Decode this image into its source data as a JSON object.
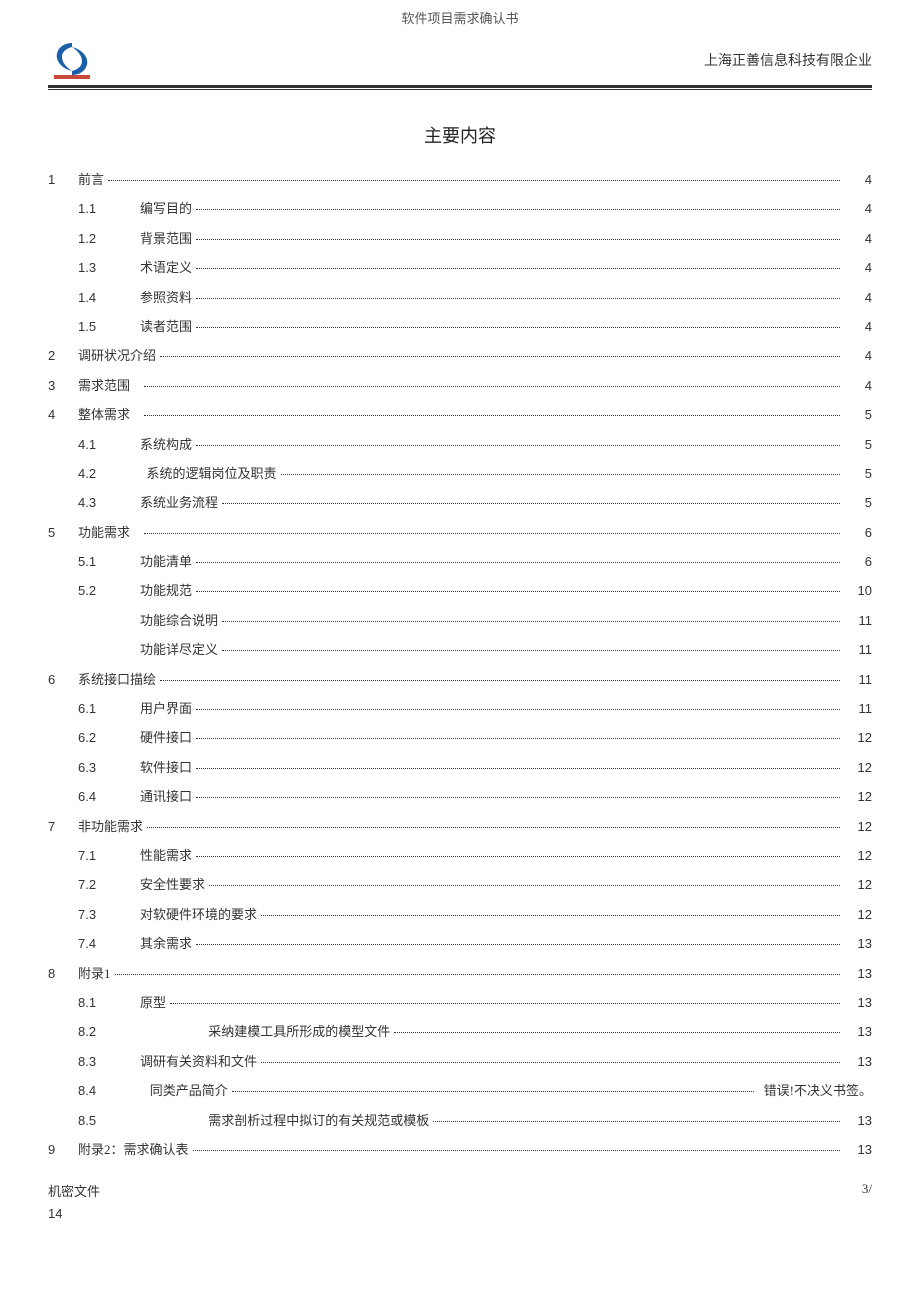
{
  "doc_header": "软件项目需求确认书",
  "company": "上海正善信息科技有限企业",
  "toc_title": "主要内容",
  "toc": [
    {
      "level": 1,
      "num": "1",
      "label": "前言",
      "page": "4"
    },
    {
      "level": 2,
      "num": "1.1",
      "label": "编写目的",
      "page": "4"
    },
    {
      "level": 2,
      "num": "1.2",
      "label": "背景范围",
      "page": "4"
    },
    {
      "level": 2,
      "num": "1.3",
      "label": "术语定义",
      "page": "4"
    },
    {
      "level": 2,
      "num": "1.4",
      "label": "参照资料",
      "page": "4"
    },
    {
      "level": 2,
      "num": "1.5",
      "label": "读者范围",
      "page": "4"
    },
    {
      "level": 1,
      "num": "2",
      "label": "调研状况介绍",
      "page": "4"
    },
    {
      "level": 1,
      "num": "3",
      "label": "需求范围   ",
      "page": "4"
    },
    {
      "level": 1,
      "num": "4",
      "label": "整体需求   ",
      "page": "5"
    },
    {
      "level": 2,
      "num": "4.1",
      "label": "系统构成",
      "page": "5"
    },
    {
      "level": 2,
      "num": "4.2",
      "label": "  系统的逻辑岗位及职责",
      "page": "5"
    },
    {
      "level": 2,
      "num": "4.3",
      "label": "系统业务流程",
      "page": "5"
    },
    {
      "level": 1,
      "num": "5",
      "label": "功能需求   ",
      "page": "6"
    },
    {
      "level": 2,
      "num": "5.1",
      "label": "功能清单",
      "page": "6"
    },
    {
      "level": 2,
      "num": "5.2",
      "label": "功能规范",
      "page": "10"
    },
    {
      "level": 2,
      "num": "",
      "label": "功能综合说明",
      "page": "11"
    },
    {
      "level": 2,
      "num": "",
      "label": "功能详尽定义",
      "page": "11"
    },
    {
      "level": 1,
      "num": "6",
      "label": "系统接口描绘",
      "page": "11"
    },
    {
      "level": 2,
      "num": "6.1",
      "label": "用户界面",
      "page": "11"
    },
    {
      "level": 2,
      "num": "6.2",
      "label": "硬件接口",
      "page": "12"
    },
    {
      "level": 2,
      "num": "6.3",
      "label": "软件接口",
      "page": "12"
    },
    {
      "level": 2,
      "num": "6.4",
      "label": "通讯接口",
      "page": "12"
    },
    {
      "level": 1,
      "num": "7",
      "label": "非功能需求",
      "page": "12"
    },
    {
      "level": 2,
      "num": "7.1",
      "label": "性能需求",
      "page": "12"
    },
    {
      "level": 2,
      "num": "7.2",
      "label": "安全性要求",
      "page": "12"
    },
    {
      "level": 2,
      "num": "7.3",
      "label": "对软硬件环境的要求",
      "page": "12"
    },
    {
      "level": 2,
      "num": "7.4",
      "label": "其余需求",
      "page": "13"
    },
    {
      "level": 1,
      "num": "8",
      "label": "附录1",
      "page": "13"
    },
    {
      "level": 2,
      "num": "8.1",
      "label": "原型",
      "page": "13"
    },
    {
      "level": 2,
      "num": "8.2",
      "label": "                     采纳建模工具所形成的模型文件",
      "page": "13"
    },
    {
      "level": 2,
      "num": "8.3",
      "label": "调研有关资料和文件",
      "page": "13"
    },
    {
      "level": 2,
      "num": "8.4",
      "label": "   同类产品简介",
      "page_text": "错误!不决义书签。"
    },
    {
      "level": 2,
      "num": "8.5",
      "label": "                     需求剖析过程中拟订的有关规范或模板",
      "page": "13"
    },
    {
      "level": 1,
      "num": "9",
      "label": "附录2：需求确认表",
      "page": "13"
    }
  ],
  "footer_left": "机密文件",
  "footer_right": "3/",
  "footer_second": "14"
}
